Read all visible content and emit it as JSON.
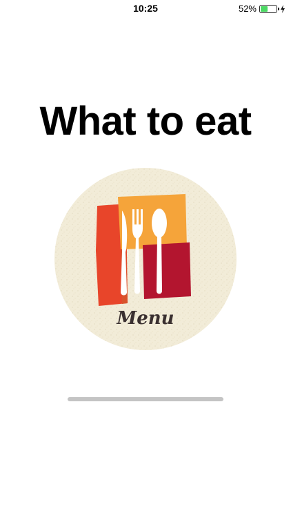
{
  "status_bar": {
    "time": "10:25",
    "battery_percent": "52%",
    "battery_level": 0.52,
    "charging": true
  },
  "title": "What to eat",
  "logo": {
    "caption": "Menu",
    "icon": "cutlery-icon",
    "colors": {
      "plate": "#f2ecd8",
      "red": "#e8452a",
      "orange": "#f5a43a",
      "crimson": "#b3152f",
      "utensils": "#ffffff"
    }
  },
  "loading_bar": {
    "color": "#c4c4c4"
  }
}
